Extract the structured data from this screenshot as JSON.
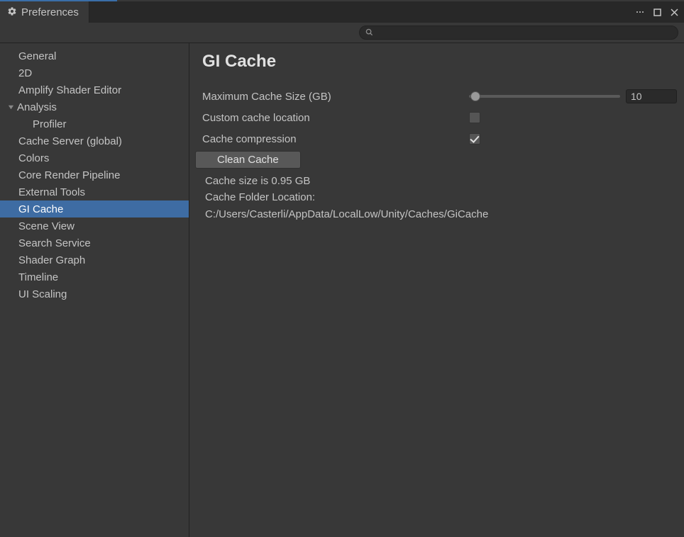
{
  "tab": {
    "title": "Preferences"
  },
  "search": {
    "placeholder": ""
  },
  "sidebar": {
    "items": [
      {
        "label": "General"
      },
      {
        "label": "2D"
      },
      {
        "label": "Amplify Shader Editor"
      },
      {
        "label": "Analysis"
      },
      {
        "label": "Profiler"
      },
      {
        "label": "Cache Server (global)"
      },
      {
        "label": "Colors"
      },
      {
        "label": "Core Render Pipeline"
      },
      {
        "label": "External Tools"
      },
      {
        "label": "GI Cache"
      },
      {
        "label": "Scene View"
      },
      {
        "label": "Search Service"
      },
      {
        "label": "Shader Graph"
      },
      {
        "label": "Timeline"
      },
      {
        "label": "UI Scaling"
      }
    ]
  },
  "main": {
    "title": "GI Cache",
    "max_cache_label": "Maximum Cache Size (GB)",
    "max_cache_value": "10",
    "custom_location_label": "Custom cache location",
    "custom_location_checked": false,
    "compression_label": "Cache compression",
    "compression_checked": true,
    "clean_button": "Clean Cache",
    "cache_size_info": "Cache size is 0.95 GB",
    "folder_label": "Cache Folder Location:",
    "folder_path": "C:/Users/Casterli/AppData/LocalLow/Unity/Caches/GiCache"
  }
}
